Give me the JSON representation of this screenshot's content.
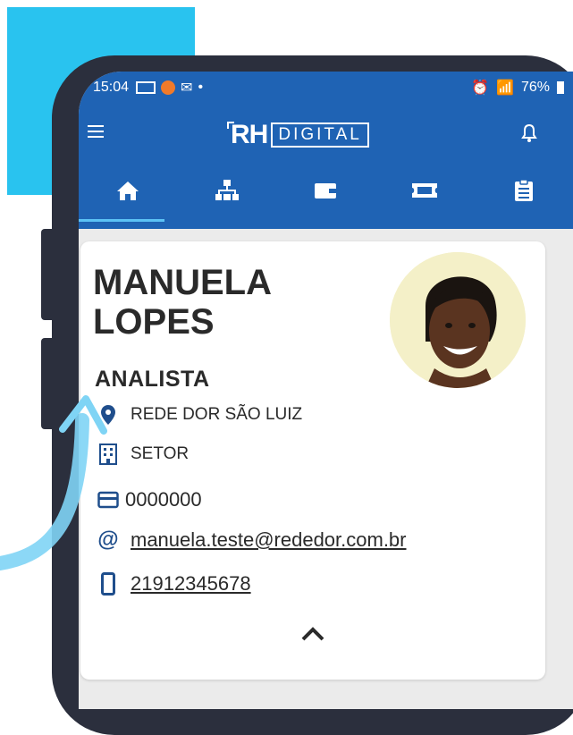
{
  "status_bar": {
    "time": "15:04",
    "battery": "76%"
  },
  "app_bar": {
    "logo_rh": "RH",
    "logo_digital": "DIGITAL"
  },
  "tabs": [
    {
      "icon": "home-icon",
      "active": true
    },
    {
      "icon": "org-chart-icon",
      "active": false
    },
    {
      "icon": "wallet-icon",
      "active": false
    },
    {
      "icon": "ticket-icon",
      "active": false
    },
    {
      "icon": "clipboard-icon",
      "active": false
    }
  ],
  "profile": {
    "first_name": "MANUELA",
    "last_name": "LOPES",
    "role": "ANALISTA",
    "location": "REDE DOR SÃO LUIZ",
    "sector": "SETOR",
    "registration": "0000000",
    "email": "manuela.teste@rededor.com.br",
    "phone": "21912345678"
  },
  "colors": {
    "primary": "#1f63b4",
    "accent": "#29c3ef",
    "tab_indicator": "#5cc2f5",
    "phone_frame": "#2b2f3d",
    "text": "#2a2a2a"
  }
}
